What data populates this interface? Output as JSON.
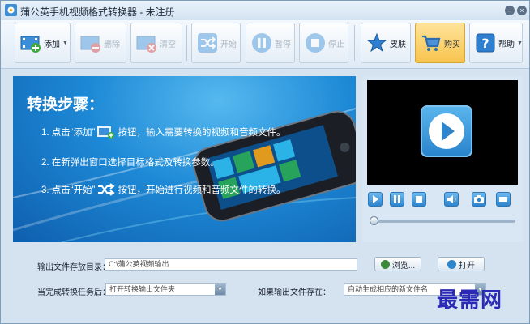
{
  "window": {
    "title": "蒲公英手机视频格式转换器 - 未注册"
  },
  "toolbar": {
    "add_label": "添加",
    "delete_label": "删除",
    "clear_label": "清空",
    "start_label": "开始",
    "pause_label": "暂停",
    "stop_label": "停止",
    "skin_label": "皮肤",
    "buy_label": "购买",
    "help_label": "帮助"
  },
  "banner": {
    "title": "转换步骤：",
    "step1_pre": "1. 点击“添加”",
    "step1_post": "按钮，输入需要转换的视频和音频文件。",
    "step2": "2. 在新弹出窗口选择目标格式及转换参数。",
    "step3_pre": "3. 点击“开始”",
    "step3_post": "按钮，开始进行视频和音频文件的转换。"
  },
  "player": {
    "seek_fraction": 0
  },
  "settings": {
    "output_dir_label": "输出文件存放目录：",
    "output_dir_value": "C:\\蒲公英视频输出",
    "browse_label": "浏览...",
    "open_label": "打开",
    "after_task_label": "当完成转换任务后：",
    "after_task_value": "打开转换输出文件夹",
    "if_exists_label": "如果输出文件存在：",
    "if_exists_value": "自动生成相应的新文件名"
  },
  "watermark": {
    "text": "最需网"
  },
  "colors": {
    "accent": "#2f85cc",
    "buy_highlight": "#f8c44e",
    "watermark": "#2a2ab7"
  }
}
